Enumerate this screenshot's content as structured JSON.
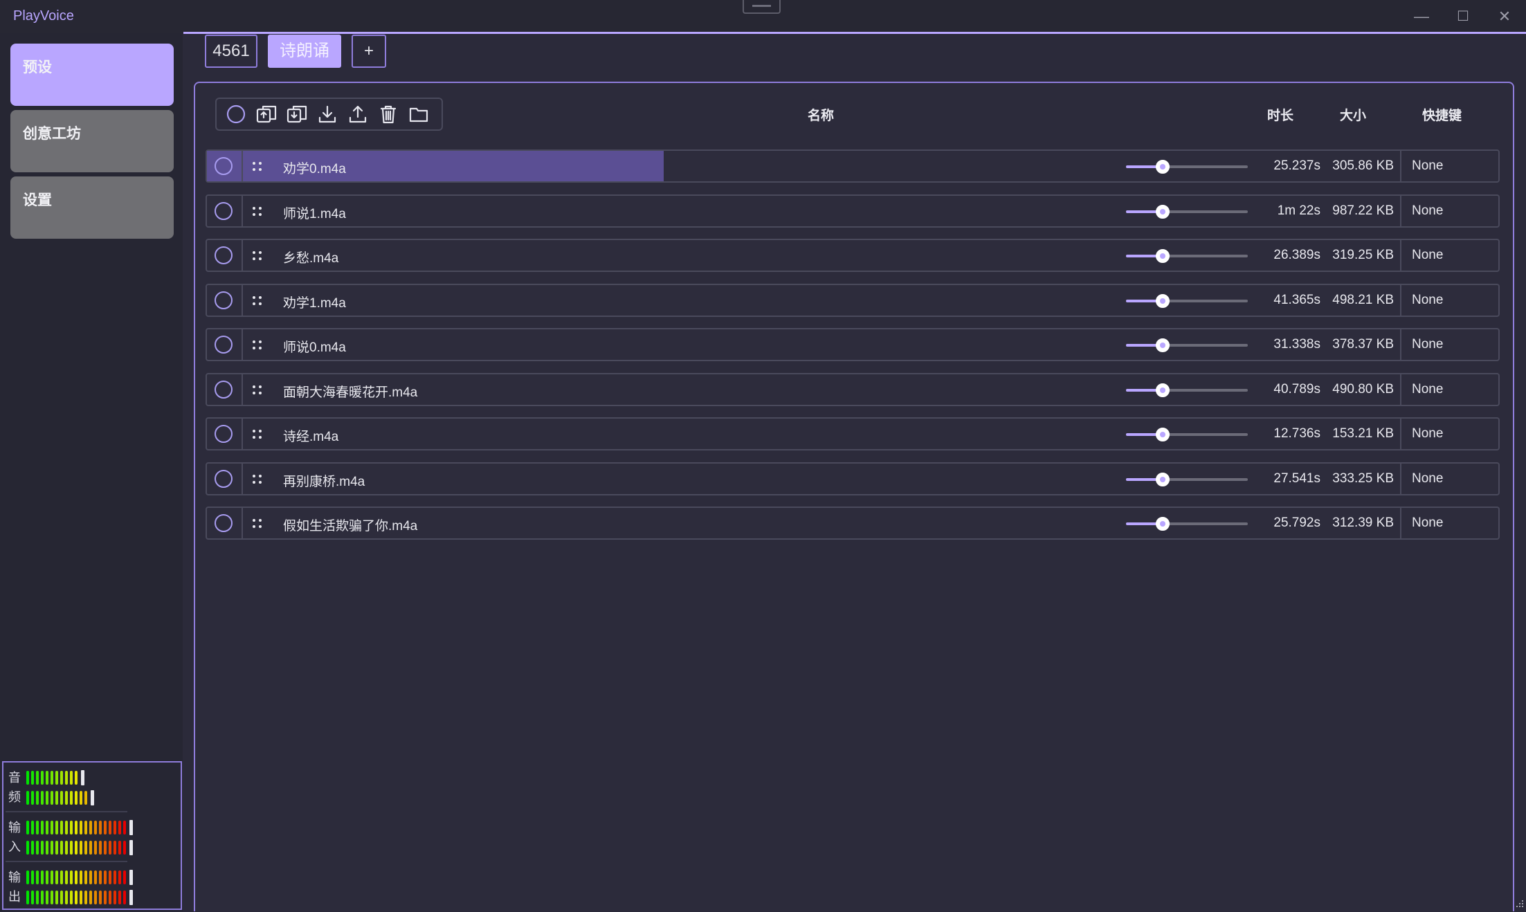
{
  "app": {
    "title": "PlayVoice"
  },
  "window_controls": {
    "minimize": "—",
    "maximize": "☐",
    "close": "✕"
  },
  "sidebar": {
    "items": [
      {
        "label": "预设",
        "active": true
      },
      {
        "label": "创意工坊",
        "active": false
      },
      {
        "label": "设置",
        "active": false
      }
    ]
  },
  "meters": {
    "audio": {
      "label_1": "音",
      "label_2": "频"
    },
    "input": {
      "label_1": "输",
      "label_2": "入"
    },
    "output": {
      "label_1": "输",
      "label_2": "出"
    }
  },
  "tabs": [
    {
      "label": "4561",
      "active": false
    },
    {
      "label": "诗朗诵",
      "active": true
    },
    {
      "label": "+",
      "active": false
    }
  ],
  "toolbar": {
    "icons": [
      "circle-select-icon",
      "import-copy-icon",
      "export-copy-icon",
      "download-icon",
      "upload-icon",
      "trash-icon",
      "folder-icon"
    ]
  },
  "columns": {
    "name": "名称",
    "duration": "时长",
    "size": "大小",
    "hotkey": "快捷键"
  },
  "rows": [
    {
      "name": "劝学0.m4a",
      "duration": "25.237s",
      "size": "305.86 KB",
      "hotkey": "None",
      "volume": 0.3,
      "progress": 0.5
    },
    {
      "name": "师说1.m4a",
      "duration": "1m 22s",
      "size": "987.22 KB",
      "hotkey": "None",
      "volume": 0.3,
      "progress": 0
    },
    {
      "name": "乡愁.m4a",
      "duration": "26.389s",
      "size": "319.25 KB",
      "hotkey": "None",
      "volume": 0.3,
      "progress": 0
    },
    {
      "name": "劝学1.m4a",
      "duration": "41.365s",
      "size": "498.21 KB",
      "hotkey": "None",
      "volume": 0.3,
      "progress": 0
    },
    {
      "name": "师说0.m4a",
      "duration": "31.338s",
      "size": "378.37 KB",
      "hotkey": "None",
      "volume": 0.3,
      "progress": 0
    },
    {
      "name": "面朝大海春暖花开.m4a",
      "duration": "40.789s",
      "size": "490.80 KB",
      "hotkey": "None",
      "volume": 0.3,
      "progress": 0
    },
    {
      "name": "诗经.m4a",
      "duration": "12.736s",
      "size": "153.21 KB",
      "hotkey": "None",
      "volume": 0.3,
      "progress": 0
    },
    {
      "name": "再别康桥.m4a",
      "duration": "27.541s",
      "size": "333.25 KB",
      "hotkey": "None",
      "volume": 0.3,
      "progress": 0
    },
    {
      "name": "假如生活欺骗了你.m4a",
      "duration": "25.792s",
      "size": "312.39 KB",
      "hotkey": "None",
      "volume": 0.3,
      "progress": 0
    }
  ],
  "colors": {
    "accent": "#b9a6ff",
    "background": "#2b2a3a",
    "progress_fill": "#5b4f94"
  }
}
